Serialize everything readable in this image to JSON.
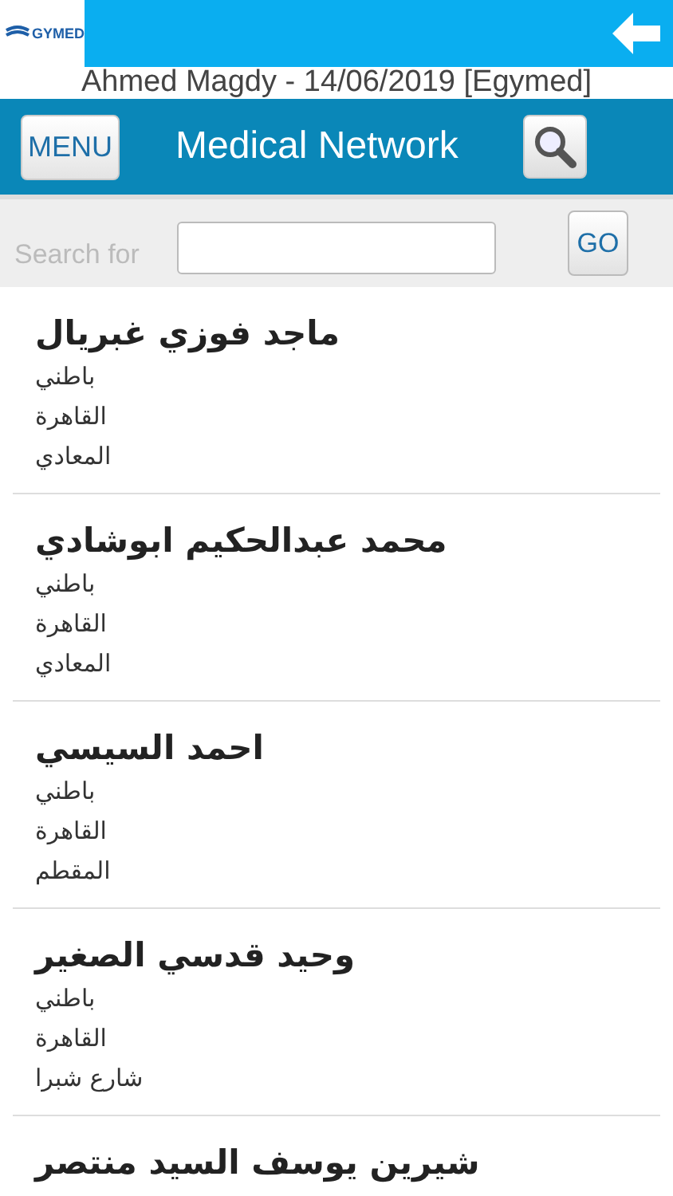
{
  "top_bar": {
    "logo_text": "GYMED"
  },
  "user_line": "Ahmed Magdy - 14/06/2019 [Egymed]",
  "header": {
    "menu_button": "MENU",
    "title": "Medical Network"
  },
  "search": {
    "label": "Search for",
    "go_button": "GO"
  },
  "doctors": [
    {
      "name": "ماجد فوزي غبريال",
      "details": [
        "باطني",
        "القاهرة",
        "المعادي"
      ]
    },
    {
      "name": "محمد عبدالحكيم ابوشادي",
      "details": [
        "باطني",
        "القاهرة",
        "المعادي"
      ]
    },
    {
      "name": "احمد السيسي",
      "details": [
        "باطني",
        "القاهرة",
        "المقطم"
      ]
    },
    {
      "name": "وحيد قدسي الصغير",
      "details": [
        "باطني",
        "القاهرة",
        "شارع شبرا"
      ]
    },
    {
      "name": "شيرين يوسف السيد منتصر"
    }
  ]
}
